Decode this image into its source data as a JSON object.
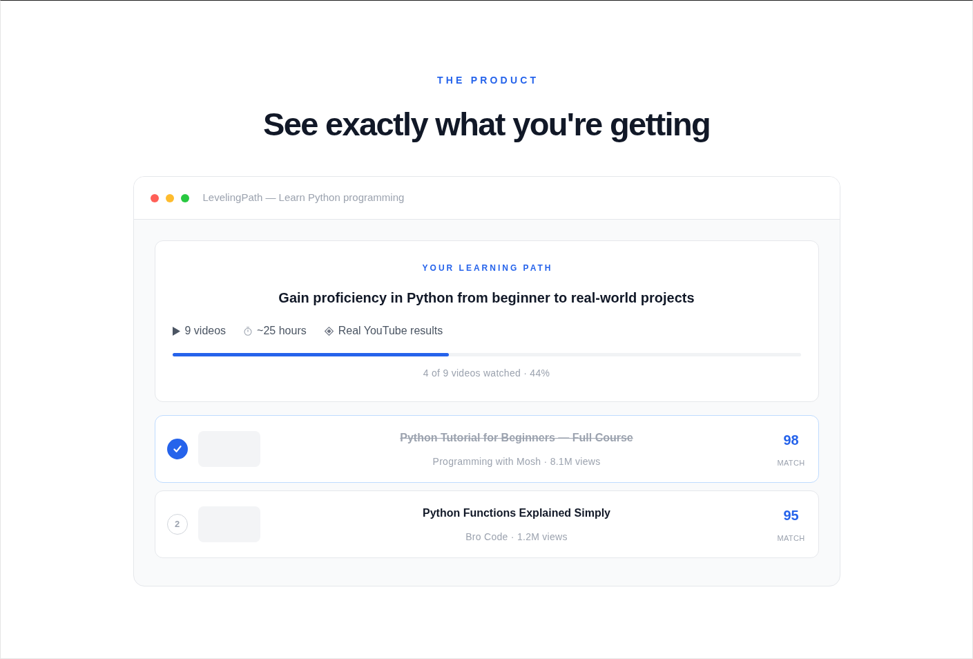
{
  "eyebrow": "THE PRODUCT",
  "heading": "See exactly what you're getting",
  "window": {
    "controls": [
      {
        "color": "#ff5f57"
      },
      {
        "color": "#febc2e"
      },
      {
        "color": "#28c840"
      }
    ],
    "title": "LevelingPath — Learn Python programming"
  },
  "path_card": {
    "label": "YOUR LEARNING PATH",
    "goal": "Gain proficiency in Python from beginner to real-world projects",
    "meta": [
      {
        "kind": "videos",
        "text": "9 videos"
      },
      {
        "kind": "duration",
        "text": "~25 hours"
      },
      {
        "kind": "source",
        "text": "Real YouTube results"
      }
    ],
    "progress": {
      "level": 0.44,
      "caption": "4 of 9 videos watched · 44%"
    }
  },
  "videos": [
    {
      "watched": true,
      "title": "Python Tutorial for Beginners — Full Course",
      "meta": "Programming with Mosh · 8.1M views",
      "score": "98",
      "score_label": "MATCH"
    },
    {
      "watched": false,
      "number": "2",
      "title": "Python Functions Explained Simply",
      "meta": "Bro Code · 1.2M views",
      "score": "95",
      "score_label": "MATCH"
    }
  ]
}
